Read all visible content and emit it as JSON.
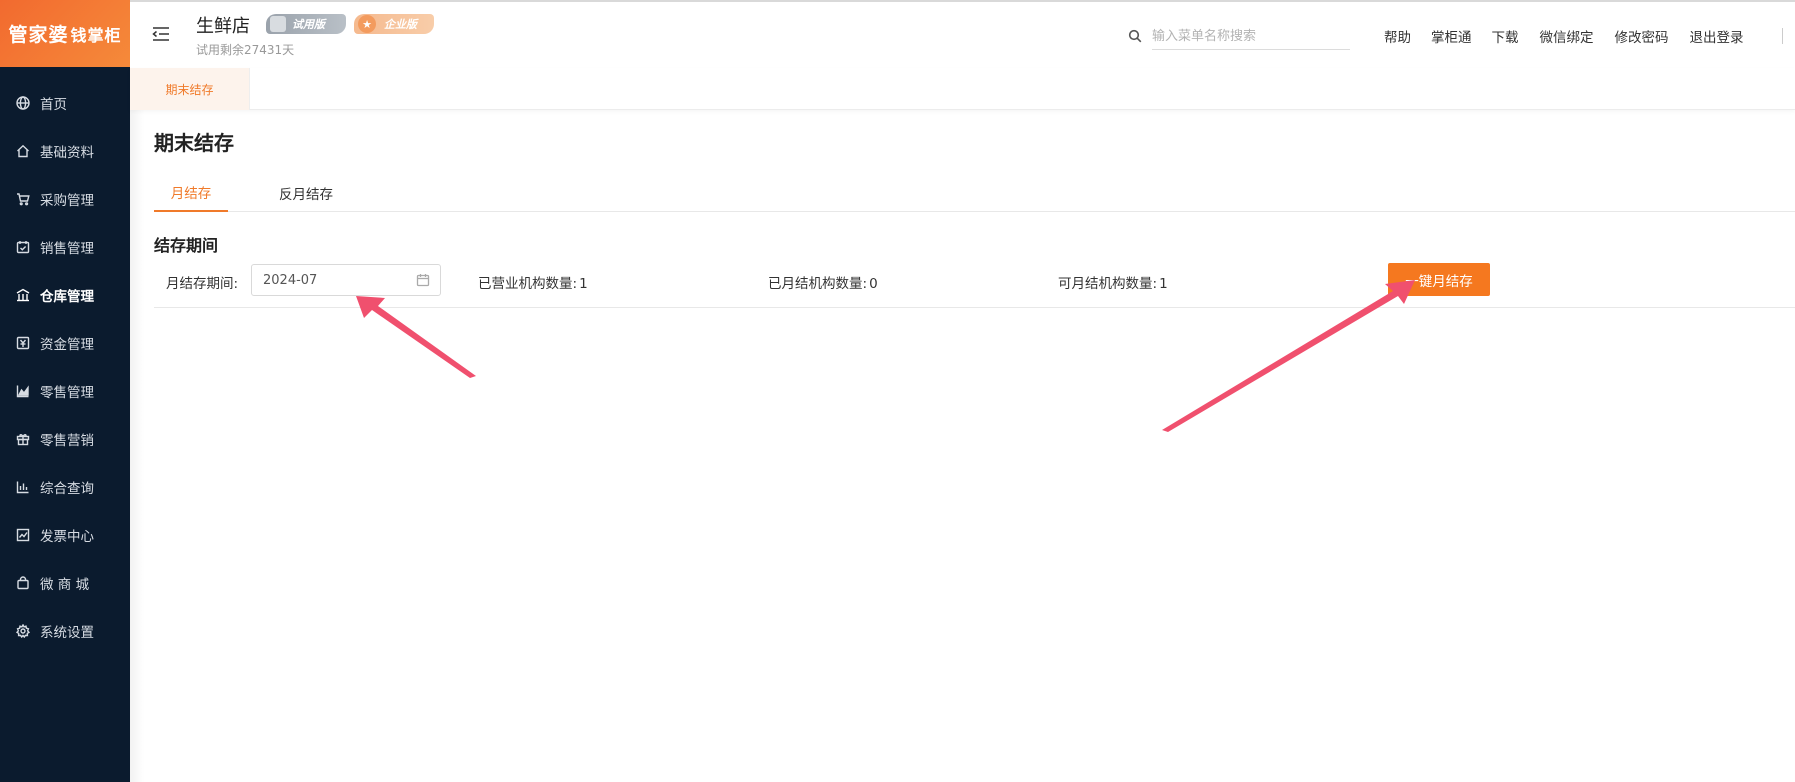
{
  "sidebar": {
    "logo_main": "管家婆",
    "logo_sub": "钱掌柜",
    "items": [
      {
        "label": "首页",
        "icon": "globe-icon"
      },
      {
        "label": "基础资料",
        "icon": "home-icon"
      },
      {
        "label": "采购管理",
        "icon": "cart-icon"
      },
      {
        "label": "销售管理",
        "icon": "calendar-check-icon"
      },
      {
        "label": "仓库管理",
        "icon": "warehouse-icon"
      },
      {
        "label": "资金管理",
        "icon": "money-icon"
      },
      {
        "label": "零售管理",
        "icon": "area-chart-icon"
      },
      {
        "label": "零售营销",
        "icon": "gift-icon"
      },
      {
        "label": "综合查询",
        "icon": "bar-chart-icon"
      },
      {
        "label": "发票中心",
        "icon": "line-chart-icon"
      },
      {
        "label": "微 商 城",
        "icon": "bag-icon"
      },
      {
        "label": "系统设置",
        "icon": "gear-icon"
      }
    ],
    "active_index": 4
  },
  "header": {
    "store_name": "生鲜店",
    "badge_trial": "试用版",
    "badge_enterprise": "企业版",
    "trial_days": "试用剩余27431天",
    "search_placeholder": "输入菜单名称搜索",
    "links": [
      "帮助",
      "掌柜通",
      "下载",
      "微信绑定",
      "修改密码",
      "退出登录"
    ]
  },
  "tabstrip": {
    "active_tab": "期末结存"
  },
  "main": {
    "title": "期末结存",
    "subtabs": [
      "月结存",
      "反月结存"
    ],
    "section_title": "结存期间",
    "period_label": "月结存期间:",
    "period_value": "2024-07",
    "stats": [
      {
        "label": "已营业机构数量:",
        "value": "1"
      },
      {
        "label": "已月结机构数量:",
        "value": "0"
      },
      {
        "label": "可月结机构数量:",
        "value": "1"
      }
    ],
    "action_button": "一键月结存"
  },
  "colors": {
    "accent": "#f5781f",
    "sidebar_bg": "#0b1b2e",
    "annotation_arrow": "#f0506e"
  }
}
